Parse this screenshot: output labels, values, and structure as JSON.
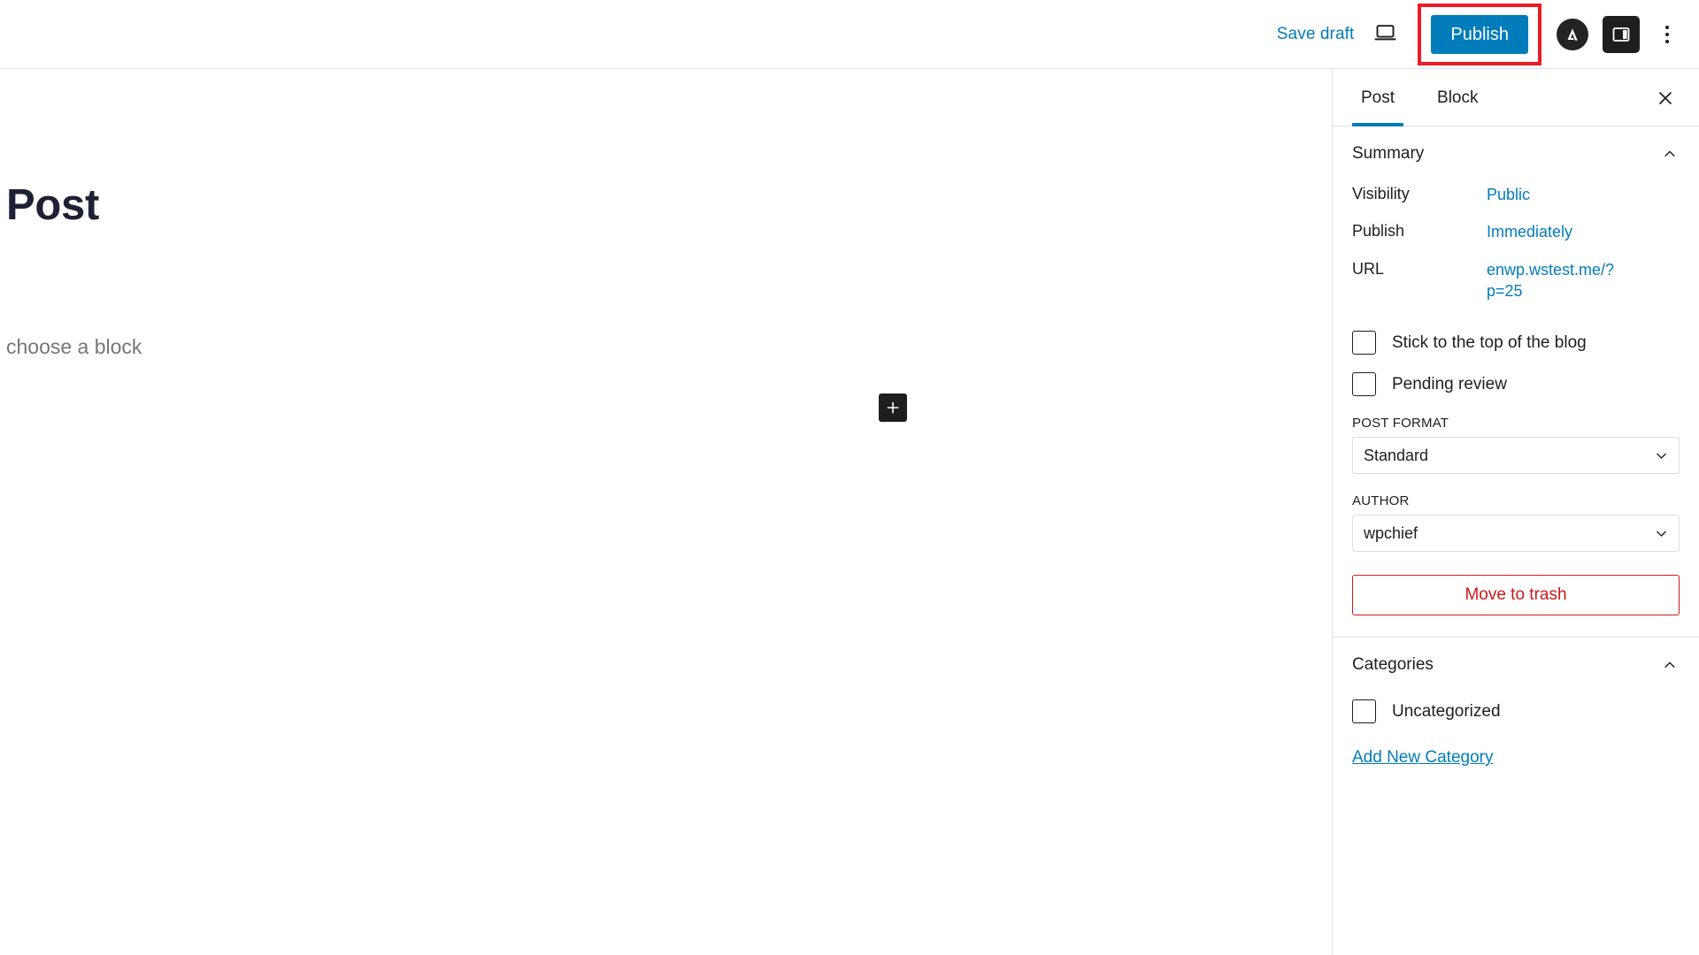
{
  "header": {
    "save_draft_label": "Save draft",
    "preview_icon": "laptop-preview-icon",
    "publish_label": "Publish",
    "astra_icon": "astra-logo-icon",
    "sidebar_toggle_icon": "settings-sidebar-icon",
    "options_icon": "kebab-menu-icon",
    "highlight_color": "#ec1c24",
    "publish_bg": "#007cba",
    "link_color": "#007cba"
  },
  "editor": {
    "post_title": "Post",
    "block_placeholder": "choose a block",
    "add_block_label": "+"
  },
  "sidebar": {
    "tabs": [
      {
        "label": "Post",
        "active": true
      },
      {
        "label": "Block",
        "active": false
      }
    ],
    "close_icon": "close-icon",
    "summary": {
      "title": "Summary",
      "collapse_icon": "chevron-up-icon",
      "rows": [
        {
          "label": "Visibility",
          "value": "Public"
        },
        {
          "label": "Publish",
          "value": "Immediately"
        },
        {
          "label": "URL",
          "value": "enwp.wstest.me/?p=25"
        }
      ],
      "checkboxes": [
        {
          "label": "Stick to the top of the blog",
          "checked": false
        },
        {
          "label": "Pending review",
          "checked": false
        }
      ],
      "post_format": {
        "label": "POST FORMAT",
        "value": "Standard"
      },
      "author": {
        "label": "AUTHOR",
        "value": "wpchief"
      },
      "trash_label": "Move to trash",
      "trash_color": "#cc1818"
    },
    "categories": {
      "title": "Categories",
      "collapse_icon": "chevron-up-icon",
      "items": [
        {
          "label": "Uncategorized",
          "checked": false
        }
      ],
      "add_new_label": "Add New Category"
    }
  }
}
